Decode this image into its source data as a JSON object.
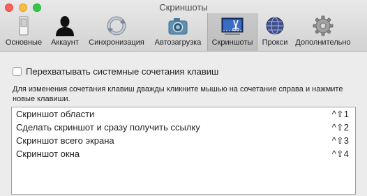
{
  "window": {
    "title": "Скриншоты",
    "accent_color": "#34c84a"
  },
  "toolbar": {
    "tabs": [
      {
        "label": "Основные",
        "icon": "switch-icon"
      },
      {
        "label": "Аккаунт",
        "icon": "user-silhouette-icon"
      },
      {
        "label": "Синхронизация",
        "icon": "sync-arrows-icon"
      },
      {
        "label": "Автозагрузка",
        "icon": "camera-icon"
      },
      {
        "label": "Скриншоты",
        "icon": "screenshot-scissors-icon",
        "active": true
      },
      {
        "label": "Прокси",
        "icon": "globe-icon"
      },
      {
        "label": "Дополнительно",
        "icon": "gear-icon"
      }
    ]
  },
  "settings": {
    "intercept_label": "Перехватывать системные сочетания клавиш",
    "intercept_checked": false,
    "hint": "Для изменения сочетания клавиш дважды кликните мышью на сочетание справа и нажмите новые клавиши."
  },
  "shortcuts": [
    {
      "name": "Скриншот области",
      "keys": "^⇧1"
    },
    {
      "name": "Сделать скриншот и сразу получить ссылку",
      "keys": "^⇧2"
    },
    {
      "name": "Скриншот всего экрана",
      "keys": "^⇧3"
    },
    {
      "name": "Скриншот окна",
      "keys": "^⇧4"
    }
  ]
}
